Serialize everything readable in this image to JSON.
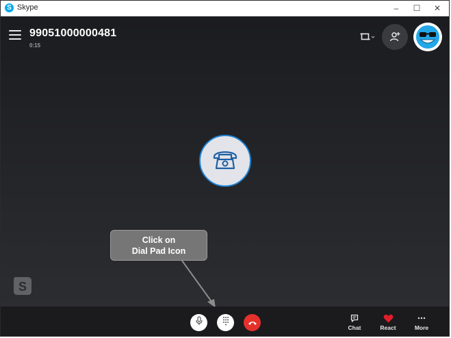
{
  "window": {
    "title": "Skype",
    "controls": {
      "minimize": "–",
      "maximize": "☐",
      "close": "✕"
    }
  },
  "call": {
    "number": "99051000000481",
    "duration": "0:15"
  },
  "tooltip": {
    "line1": "Click on",
    "line2": "Dial Pad Icon"
  },
  "bottom_bar": {
    "chat_label": "Chat",
    "react_label": "React",
    "more_label": "More"
  },
  "colors": {
    "end_call": "#e5312b",
    "accent": "#1e83d6",
    "background": "#222326"
  },
  "icons": [
    "menu-icon",
    "layout-icon",
    "add-person-icon",
    "avatar-icon",
    "phone-icon",
    "skype-logo-icon",
    "microphone-icon",
    "dialpad-icon",
    "end-call-icon",
    "chat-icon",
    "heart-icon",
    "more-icon"
  ]
}
